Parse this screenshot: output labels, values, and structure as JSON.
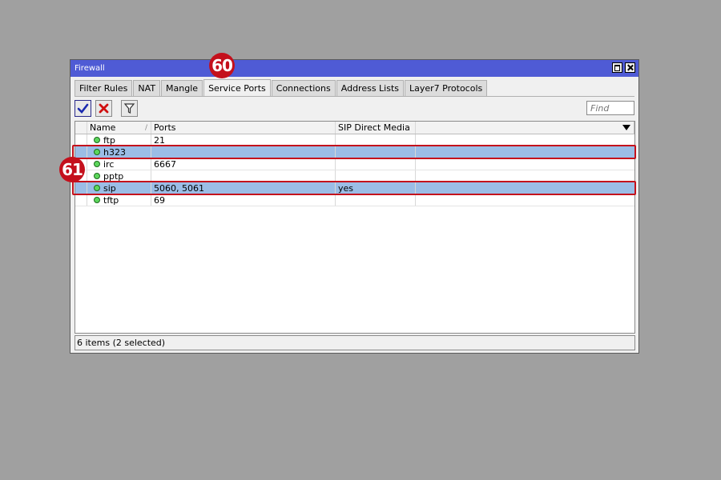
{
  "window": {
    "title": "Firewall"
  },
  "tabs": [
    {
      "label": "Filter Rules",
      "active": false
    },
    {
      "label": "NAT",
      "active": false
    },
    {
      "label": "Mangle",
      "active": false
    },
    {
      "label": "Service Ports",
      "active": true
    },
    {
      "label": "Connections",
      "active": false
    },
    {
      "label": "Address Lists",
      "active": false
    },
    {
      "label": "Layer7 Protocols",
      "active": false
    }
  ],
  "toolbar": {
    "enable_icon": "checkmark-icon",
    "disable_icon": "x-icon",
    "filter_icon": "funnel-icon",
    "find_placeholder": "Find"
  },
  "table": {
    "columns": [
      "Name",
      "Ports",
      "SIP Direct Media"
    ],
    "rows": [
      {
        "name": "ftp",
        "ports": "21",
        "sip_direct_media": "",
        "selected": false
      },
      {
        "name": "h323",
        "ports": "",
        "sip_direct_media": "",
        "selected": true
      },
      {
        "name": "irc",
        "ports": "6667",
        "sip_direct_media": "",
        "selected": false
      },
      {
        "name": "pptp",
        "ports": "",
        "sip_direct_media": "",
        "selected": false
      },
      {
        "name": "sip",
        "ports": "5060, 5061",
        "sip_direct_media": "yes",
        "selected": true
      },
      {
        "name": "tftp",
        "ports": "69",
        "sip_direct_media": "",
        "selected": false
      }
    ]
  },
  "status": {
    "text": "6 items (2 selected)"
  },
  "annotations": {
    "badge_tabs": "60",
    "badge_rows": "61"
  },
  "colors": {
    "titlebar": "#4f5bd5",
    "selected_row": "#9bbde6",
    "annotation": "#c4101c",
    "enabled_dot": "#5cd65c"
  }
}
